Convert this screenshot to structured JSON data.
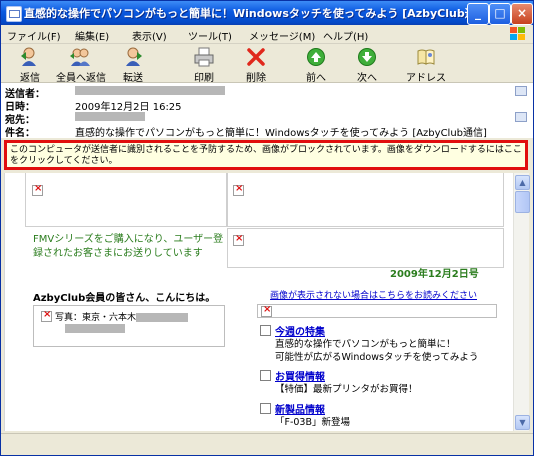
{
  "window": {
    "title": "直感的な操作でパソコンがもっと簡単に！Windowsタッチを使ってみよう [AzbyClub通信] - 日本...",
    "min_glyph": "_",
    "max_glyph": "□",
    "close_glyph": "×"
  },
  "menu": [
    "ファイル(F)",
    "編集(E)",
    "表示(V)",
    "ツール(T)",
    "メッセージ(M)",
    "ヘルプ(H)"
  ],
  "toolbar": {
    "reply": "返信",
    "reply_all": "全員へ返信",
    "forward": "転送",
    "print": "印刷",
    "delete": "削除",
    "prev": "前へ",
    "next": "次へ",
    "address": "アドレス"
  },
  "header": {
    "from_label": "送信者：",
    "date_label": "日時：",
    "date_value": "2009年12月2日 16:25",
    "to_label": "宛先：",
    "subject_label": "件名：",
    "subject_value": "直感的な操作でパソコンがもっと簡単に！Windowsタッチを使ってみよう [AzbyClub通信]"
  },
  "infobar": {
    "text": "このコンピュータが送信者に識別されることを予防するため、画像がブロックされています。画像をダウンロードするにはここをクリックしてください。"
  },
  "body": {
    "fmv_text": "FMVシリーズをご購入になり、ユーザー登録されたお客さまにお送りしています",
    "issue_date": "2009年12月2日号",
    "greeting": "AzbyClub会員の皆さん、こんにちは。",
    "image_notice": "画像が表示されない場合はこちらをお読みください",
    "photo_caption": "写真：東京・六本木",
    "sections": [
      {
        "title": "今週の特集",
        "lines": [
          "直感的な操作でパソコンがもっと簡単に！",
          "可能性が広がるWindowsタッチを使ってみよう"
        ]
      },
      {
        "title": "お買得情報",
        "lines": [
          "【特価】最新プリンタがお買得！"
        ]
      },
      {
        "title": "新製品情報",
        "lines": [
          "「F-03B」新登場"
        ]
      }
    ]
  },
  "scroll": {
    "up": "▲",
    "down": "▼"
  }
}
